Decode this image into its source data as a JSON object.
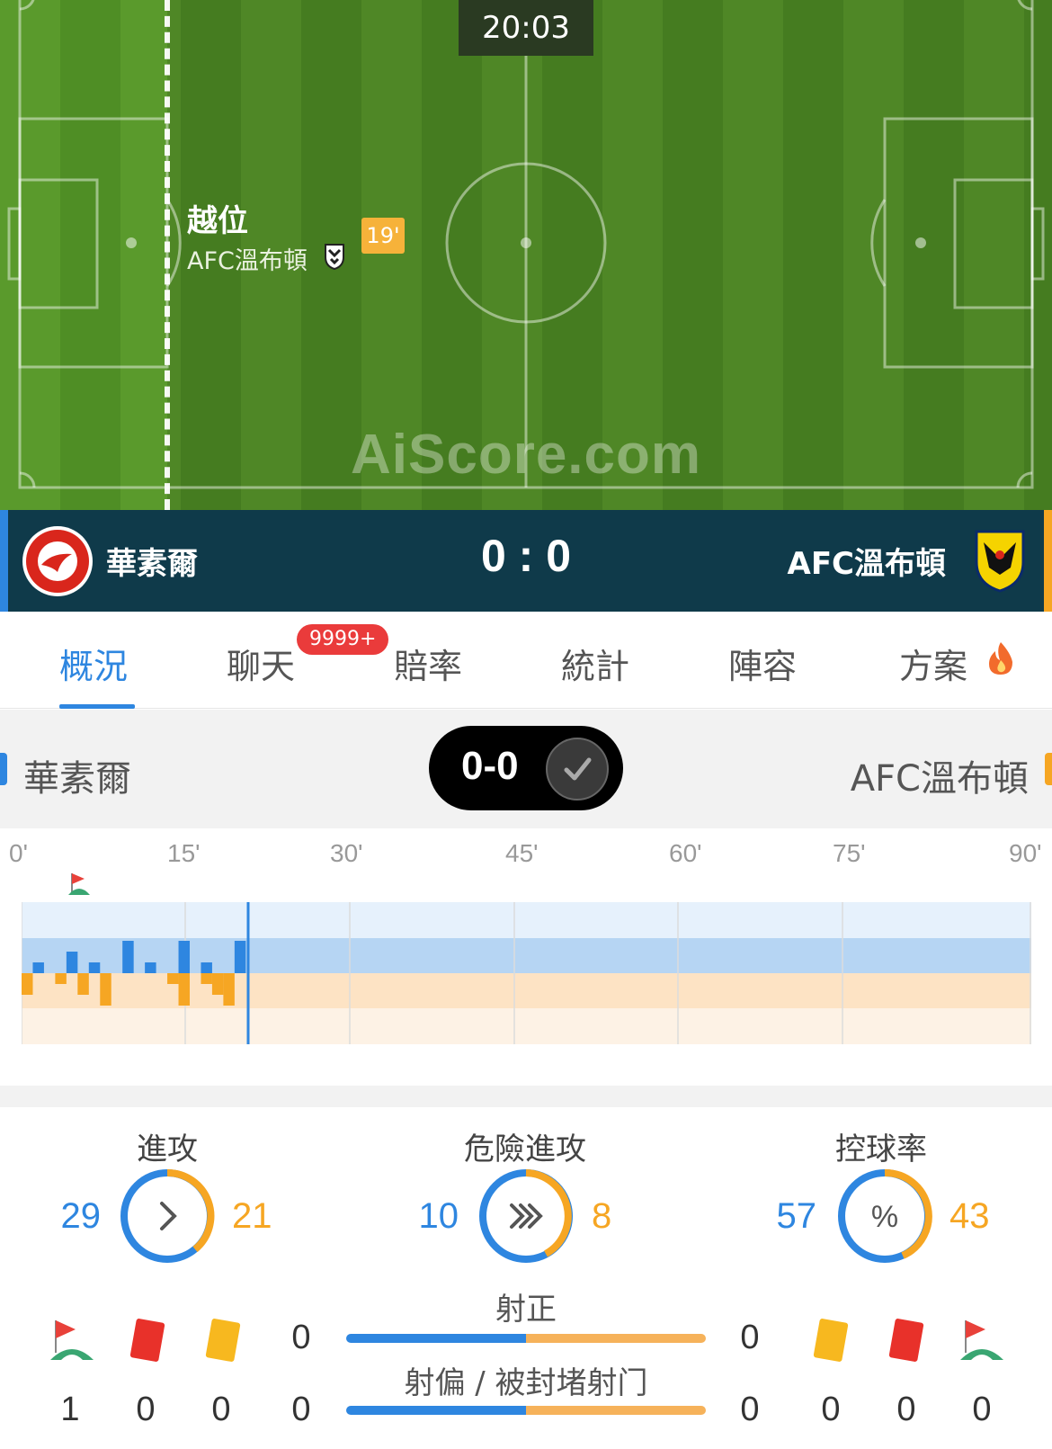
{
  "pitch": {
    "clock": "20:03",
    "event": {
      "title": "越位",
      "team": "AFC溫布頓",
      "minute": "19'"
    },
    "watermark": "AiScore.com"
  },
  "match": {
    "home_team": "華素爾",
    "away_team": "AFC溫布頓",
    "score": "0 : 0",
    "colors": {
      "home": "#2e86e0",
      "away": "#f6a623",
      "bar": "#0f3a4a"
    }
  },
  "tabs": [
    {
      "label": "概況",
      "active": true
    },
    {
      "label": "聊天",
      "badge": "9999+"
    },
    {
      "label": "賠率"
    },
    {
      "label": "統計"
    },
    {
      "label": "陣容"
    },
    {
      "label": "方案",
      "icon": "fire-icon"
    }
  ],
  "summary": {
    "home_team": "華素爾",
    "away_team": "AFC溫布頓",
    "score": "0-0",
    "status_icon": "check-icon"
  },
  "timeline": {
    "ticks": [
      "0'",
      "15'",
      "30'",
      "45'",
      "60'",
      "75'",
      "90'"
    ],
    "current_minute": 20,
    "events": [
      {
        "type": "corner",
        "minute": 5,
        "icon": "corner-flag-icon"
      }
    ],
    "home_momentum": [
      [
        2,
        1
      ],
      [
        5,
        2
      ],
      [
        7,
        1
      ],
      [
        10,
        3
      ],
      [
        12,
        1
      ],
      [
        15,
        3
      ],
      [
        17,
        1
      ],
      [
        20,
        3
      ]
    ],
    "away_momentum": [
      [
        1,
        2
      ],
      [
        4,
        1
      ],
      [
        6,
        2
      ],
      [
        8,
        3
      ],
      [
        14,
        1
      ],
      [
        15,
        3
      ],
      [
        17,
        1
      ],
      [
        18,
        2
      ],
      [
        19,
        3
      ]
    ]
  },
  "stats": {
    "attacks": {
      "label": "進攻",
      "home": "29",
      "away": "21",
      "icon": "chevron-right-icon"
    },
    "dangerous": {
      "label": "危險進攻",
      "home": "10",
      "away": "8",
      "icon": "triple-chevron-icon"
    },
    "possession": {
      "label": "控球率",
      "home": "57",
      "away": "43",
      "icon": "percent-icon"
    }
  },
  "shots": {
    "on_target": {
      "label": "射正",
      "home": "0",
      "away": "0"
    },
    "off_target": {
      "label": "射偏 / 被封堵射门",
      "home": "0",
      "away": "0"
    }
  },
  "counts": {
    "home": {
      "corners": "1",
      "red": "0",
      "yellow": "0"
    },
    "away": {
      "yellow": "0",
      "red": "0",
      "corners": "0"
    }
  }
}
